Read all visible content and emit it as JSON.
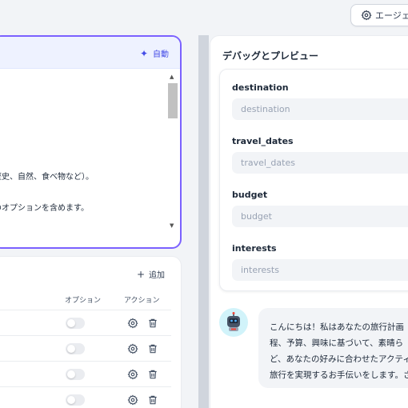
{
  "header": {
    "agent_button_label": "エージェン"
  },
  "prompt_panel": {
    "auto_button_label": "自動",
    "lines": [
      "、",
      "歴史、自然、食べ物など）。",
      "のオプションを含めます。"
    ],
    "scroll_up": "▲",
    "scroll_down": "▼"
  },
  "variables_panel": {
    "add_button_label": "追加",
    "columns": {
      "option": "オプション",
      "action": "アクション"
    },
    "rows": [
      {},
      {},
      {},
      {}
    ]
  },
  "debug_panel": {
    "title": "デバッグとプレビュー",
    "fields": [
      {
        "label": "destination",
        "placeholder": "destination"
      },
      {
        "label": "travel_dates",
        "placeholder": "travel_dates"
      },
      {
        "label": "budget",
        "placeholder": "budget"
      },
      {
        "label": "interests",
        "placeholder": "interests"
      }
    ],
    "bot_message_lines": [
      "こんにちは！私はあなたの旅行計画",
      "程、予算、興味に基づいて、素晴ら",
      "ど、あなたの好みに合わせたアクティビ",
      "旅行を実現するお手伝いをします。さ"
    ]
  },
  "colors": {
    "accent": "#7b61ff",
    "link": "#444ce7",
    "bot_avatar_bg": "#d1f3fa"
  }
}
